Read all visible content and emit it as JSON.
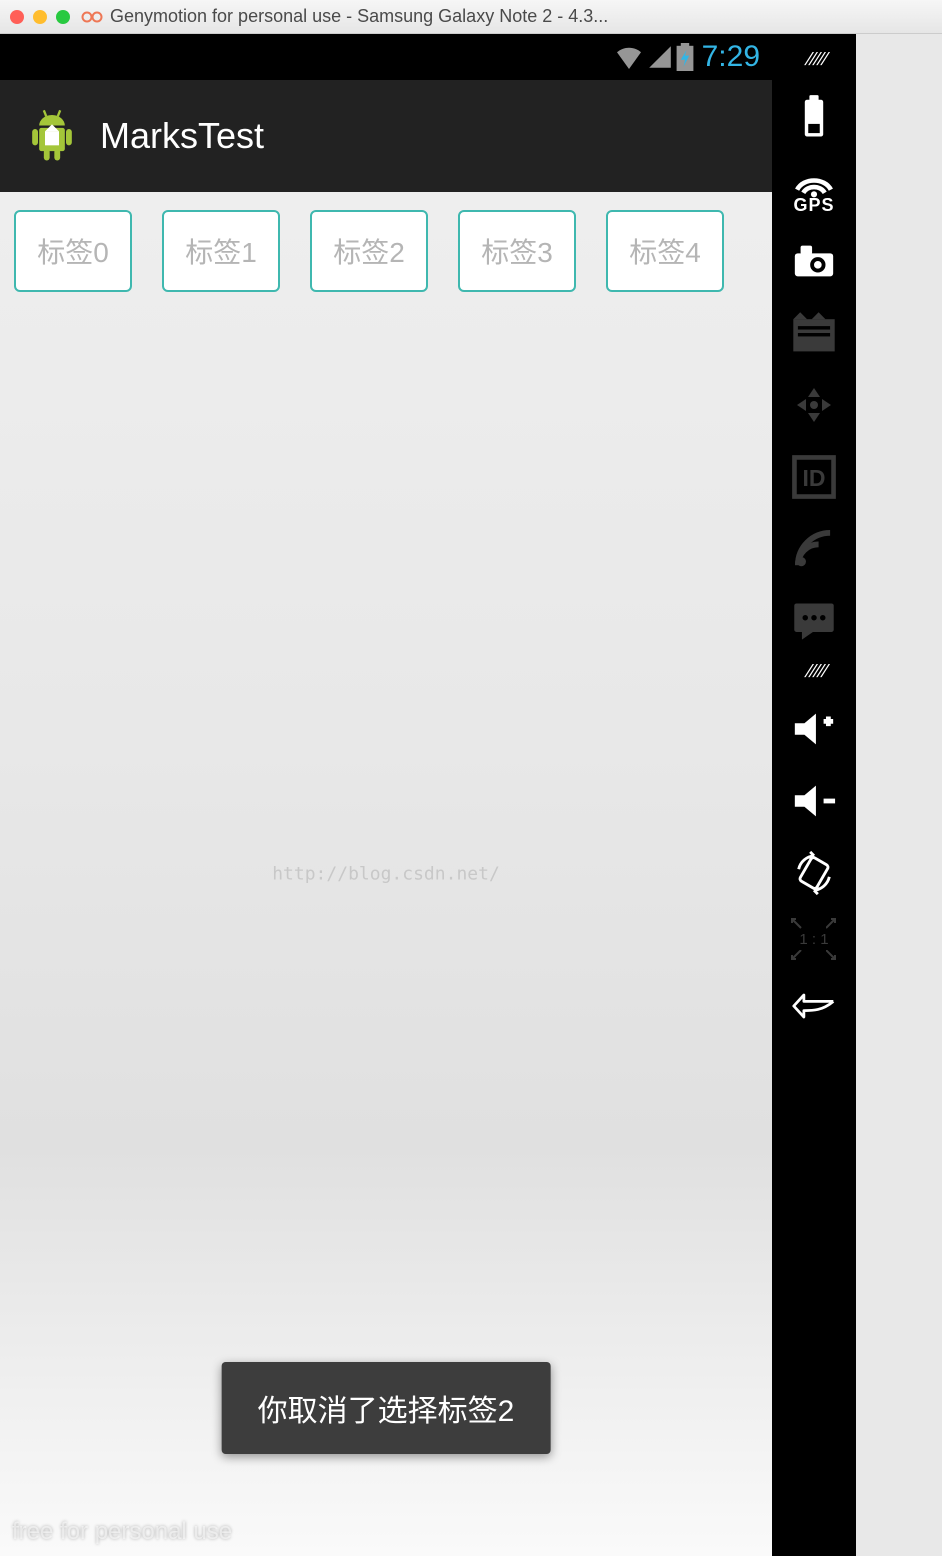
{
  "window": {
    "title": "Genymotion for personal use - Samsung Galaxy Note 2 - 4.3..."
  },
  "status": {
    "time": "7:29"
  },
  "app": {
    "title": "MarksTest"
  },
  "tags": {
    "items": [
      {
        "label": "标签0"
      },
      {
        "label": "标签1"
      },
      {
        "label": "标签2"
      },
      {
        "label": "标签3"
      },
      {
        "label": "标签4"
      }
    ]
  },
  "toast": {
    "message": "你取消了选择标签2"
  },
  "watermark": "http://blog.csdn.net/",
  "footer": {
    "free": "free for personal use"
  },
  "sidebar": {
    "gps_label": "GPS",
    "one_to_one": "1 : 1"
  }
}
